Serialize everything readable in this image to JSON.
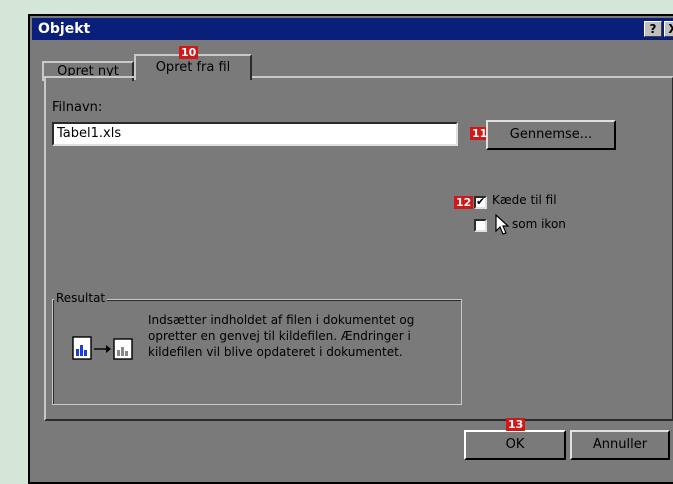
{
  "window": {
    "title": "Objekt",
    "help_button": "?",
    "close_button": "X"
  },
  "tabs": [
    {
      "label": "Opret nyt"
    },
    {
      "label": "Opret fra fil"
    }
  ],
  "filename": {
    "label": "Filnavn:",
    "value": "Tabel1.xls"
  },
  "browse_button": "Gennemse...",
  "options": [
    {
      "label": "Kæde til fil",
      "checked": true
    },
    {
      "label": "som ikon",
      "checked": false
    }
  ],
  "result": {
    "title": "Resultat",
    "text": [
      "Indsætter indholdet af filen i dokumentet og",
      "opretter en genvej til kildefilen. Ændringer i",
      "kildefilen vil blive opdateret i dokumentet."
    ]
  },
  "buttons": {
    "ok": "OK",
    "cancel": "Annuller"
  },
  "badges": [
    "10",
    "11",
    "12",
    "13"
  ],
  "colors": {
    "badge": "#d01818",
    "title_bar": "#0a1f7a",
    "dialog_bg": "#7a7a7a"
  }
}
